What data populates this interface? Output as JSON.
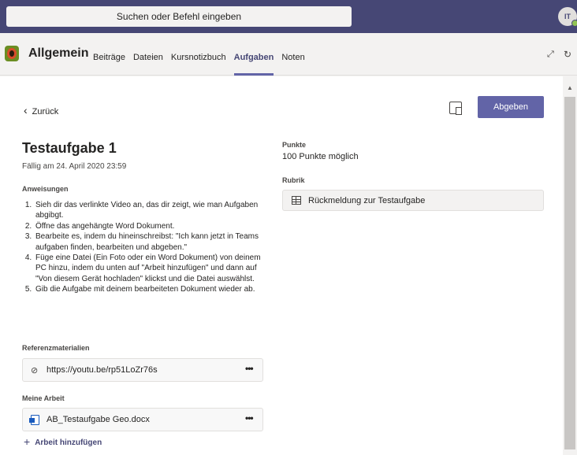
{
  "topbar": {
    "search_placeholder": "Suchen oder Befehl eingeben",
    "avatar_initials": "IT"
  },
  "channel": {
    "title": "Allgemein",
    "tabs": [
      {
        "label": "Beiträge"
      },
      {
        "label": "Dateien"
      },
      {
        "label": "Kursnotizbuch"
      },
      {
        "label": "Aufgaben",
        "active": true
      },
      {
        "label": "Noten"
      }
    ]
  },
  "assignment": {
    "back_label": "Zurück",
    "submit_label": "Abgeben",
    "title": "Testaufgabe 1",
    "due": "Fällig am 24. April 2020 23:59",
    "instructions_label": "Anweisungen",
    "instructions": [
      "Sieh dir das verlinkte Video an, das dir zeigt, wie man Aufgaben abgibgt.",
      "Öffne das angehängte Word Dokument.",
      "Bearbeite es, indem du hineinschreibst: \"Ich kann jetzt in Teams aufgaben finden, bearbeiten und abgeben.\"",
      "Füge eine Datei (Ein Foto oder ein Word Dokument) von deinem PC hinzu, indem du unten auf \"Arbeit hinzufügen\" und dann auf \"Von diesem Gerät hochladen\" klickst und die Datei auswählst.",
      "Gib die Aufgabe mit deinem bearbeiteten Dokument wieder ab."
    ],
    "reference_label": "Referenzmaterialien",
    "reference_link": "https://youtu.be/rp51LoZr76s",
    "my_work_label": "Meine Arbeit",
    "my_work_file": "AB_Testaufgabe Geo.docx",
    "add_work_label": "Arbeit hinzufügen",
    "points_label": "Punkte",
    "points_value": "100 Punkte möglich",
    "rubric_label": "Rubrik",
    "rubric_value": "Rückmeldung zur Testaufgabe",
    "more_label": "•••"
  },
  "colors": {
    "accent": "#6264a7",
    "topbar": "#464775"
  }
}
